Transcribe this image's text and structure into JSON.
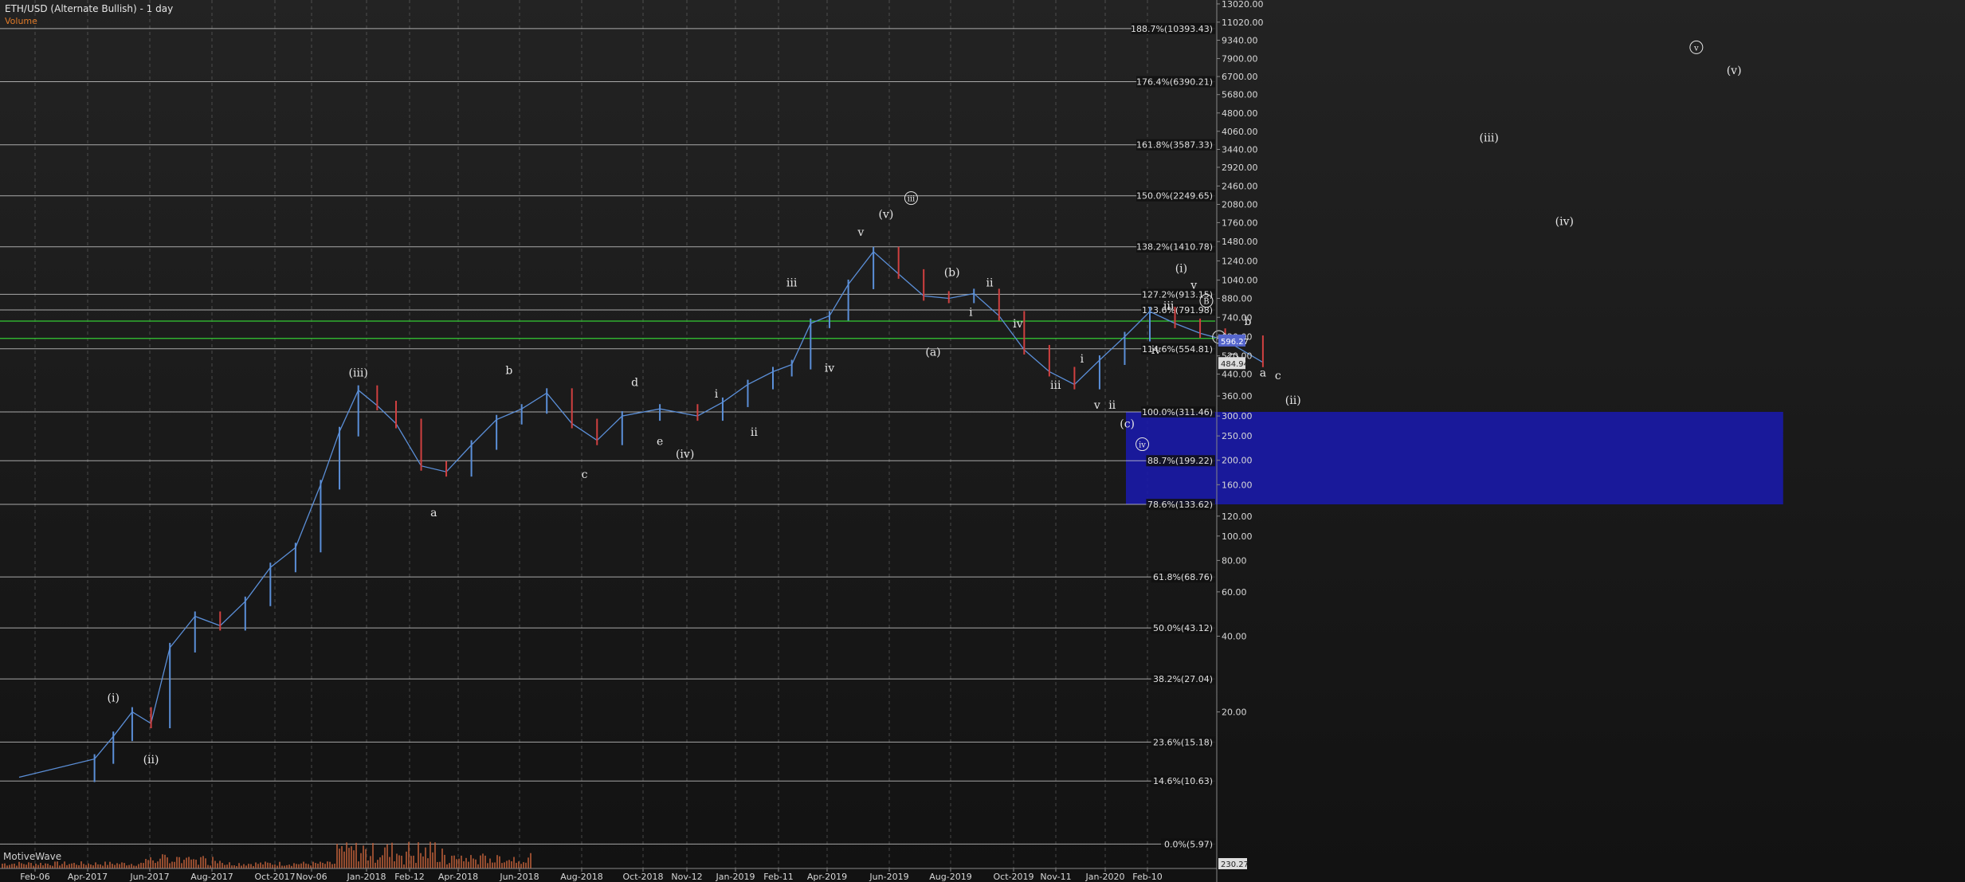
{
  "chart": {
    "title": "ETH/USD (Alternate Bullish) - 1 day",
    "volume_label": "Volume",
    "watermark": "MotiveWave"
  },
  "colors": {
    "background": "#1b1b1b",
    "grid": "#6a6a6a",
    "fib_line": "#d8d8d8",
    "support_line": "#33cc33",
    "box": "#1a1aa8",
    "candle_up": "#5b8fd8",
    "candle_down": "#d04040",
    "volume": "#c0603a",
    "label": "#e6e6e6",
    "current_price_bg": "#5566cc",
    "prev_price_bg": "#dddddd"
  },
  "chart_data": {
    "type": "line",
    "y_scale": "log",
    "ylim": [
      3.7,
      15500
    ],
    "x_tick_labels": [
      "Feb-06",
      "Apr-2017",
      "Jun-2017",
      "Aug-2017",
      "Oct-2017",
      "Nov-06",
      "Jan-2018",
      "Feb-12",
      "Apr-2018",
      "Jun-2018",
      "Aug-2018",
      "Oct-2018",
      "Nov-12",
      "Jan-2019",
      "Feb-11",
      "Apr-2019",
      "Jun-2019",
      "Aug-2019",
      "Oct-2019",
      "Nov-11",
      "Jan-2020",
      "Feb-10"
    ],
    "y_tick_labels": [
      13020,
      11020,
      9340,
      7900,
      6700,
      5680,
      4800,
      4060,
      3440,
      2920,
      2460,
      2080,
      1760,
      1480,
      1240,
      1040,
      880,
      740,
      620,
      520,
      440,
      360,
      300,
      250,
      200,
      160,
      120,
      100,
      80,
      60,
      40,
      20
    ],
    "fib_levels": [
      {
        "label": "188.7%(10393.43)",
        "value": 10393.43
      },
      {
        "label": "176.4%(6390.21)",
        "value": 6390.21
      },
      {
        "label": "161.8%(3587.33)",
        "value": 3587.33
      },
      {
        "label": "150.0%(2249.65)",
        "value": 2249.65
      },
      {
        "label": "138.2%(1410.78)",
        "value": 1410.78
      },
      {
        "label": "127.2%(913.15)",
        "value": 913.15
      },
      {
        "label": "123.6%(791.98)",
        "value": 791.98
      },
      {
        "label": "114.6%(554.81)",
        "value": 554.81
      },
      {
        "label": "100.0%(311.46)",
        "value": 311.46
      },
      {
        "label": "88.7%(199.22)",
        "value": 199.22
      },
      {
        "label": "78.6%(133.62)",
        "value": 133.62
      },
      {
        "label": "61.8%(68.76)",
        "value": 68.76
      },
      {
        "label": "50.0%(43.12)",
        "value": 43.12
      },
      {
        "label": "38.2%(27.04)",
        "value": 27.04
      },
      {
        "label": "23.6%(15.18)",
        "value": 15.18
      },
      {
        "label": "14.6%(10.63)",
        "value": 10.63
      },
      {
        "label": "0.0%(5.97)",
        "value": 5.97
      }
    ],
    "support_lines": [
      715,
      610
    ],
    "target_box": {
      "x_start": "May-2018",
      "x_end": "Jan-2019",
      "y_low": 133.62,
      "y_high": 311.46
    },
    "current_price": "596.27",
    "prev_price": "484.94",
    "volume_axis_label": "230.27",
    "price_series": [
      [
        "Feb-2017",
        11
      ],
      [
        "Mar-2017",
        13
      ],
      [
        "Mar-2017",
        16
      ],
      [
        "Mar-2017",
        20
      ],
      [
        "Mar-2017",
        18
      ],
      [
        "Apr-2017",
        36
      ],
      [
        "Apr-2017",
        48
      ],
      [
        "Apr-2017",
        44
      ],
      [
        "May-2017",
        55
      ],
      [
        "May-2017",
        75
      ],
      [
        "May-2017",
        90
      ],
      [
        "Jun-2017",
        160
      ],
      [
        "Jun-2017",
        260
      ],
      [
        "Jun-2017",
        380
      ],
      [
        "Jun-2017",
        330
      ],
      [
        "Jul-2017",
        280
      ],
      [
        "Jul-2017",
        190
      ],
      [
        "Jul-2017",
        180
      ],
      [
        "Aug-2017",
        230
      ],
      [
        "Aug-2017",
        290
      ],
      [
        "Aug-2017",
        320
      ],
      [
        "Sep-2017",
        370
      ],
      [
        "Sep-2017",
        280
      ],
      [
        "Sep-2017",
        240
      ],
      [
        "Oct-2017",
        300
      ],
      [
        "Oct-2017",
        320
      ],
      [
        "Nov-2017",
        300
      ],
      [
        "Nov-2017",
        340
      ],
      [
        "Nov-2017",
        400
      ],
      [
        "Dec-2017",
        450
      ],
      [
        "Dec-2017",
        480
      ],
      [
        "Dec-2017",
        700
      ],
      [
        "Dec-2017",
        750
      ],
      [
        "Jan-2018",
        1000
      ],
      [
        "Jan-2018",
        1350
      ],
      [
        "Jan-2018",
        1100
      ],
      [
        "Feb-2018",
        900
      ],
      [
        "Feb-2018",
        880
      ],
      [
        "Feb-2018",
        920
      ],
      [
        "Mar-2018",
        750
      ],
      [
        "Mar-2018",
        550
      ],
      [
        "Mar-2018",
        450
      ],
      [
        "Apr-2018",
        400
      ],
      [
        "Apr-2018",
        500
      ],
      [
        "Apr-2018",
        620
      ],
      [
        "May-2018",
        780
      ],
      [
        "May-2018",
        700
      ],
      [
        "May-2018",
        640
      ],
      [
        "Jun-2018",
        600
      ],
      [
        "Jun-2018",
        490
      ]
    ]
  },
  "wave_labels": [
    {
      "text": "(i)",
      "x": "Mar-2017",
      "y": 22
    },
    {
      "text": "(ii)",
      "x": "Mar-2017",
      "y": 12.5
    },
    {
      "text": "(iii)",
      "x": "Jun-2017",
      "y": 430
    },
    {
      "text": "a",
      "x": "Jul-2017",
      "y": 120
    },
    {
      "text": "b",
      "x": "Aug-2017",
      "y": 440
    },
    {
      "text": "c",
      "x": "Sep-2017",
      "y": 170
    },
    {
      "text": "d",
      "x": "Oct-2017",
      "y": 395
    },
    {
      "text": "e",
      "x": "Oct-2017",
      "y": 230
    },
    {
      "text": "(iv)",
      "x": "Oct-2017",
      "y": 205
    },
    {
      "text": "i",
      "x": "Nov-2017",
      "y": 355
    },
    {
      "text": "ii",
      "x": "Nov-2017",
      "y": 250
    },
    {
      "text": "iii",
      "x": "Dec-2017",
      "y": 980
    },
    {
      "text": "iv",
      "x": "Dec-2017",
      "y": 450
    },
    {
      "text": "v",
      "x": "Jan-2018",
      "y": 1560
    },
    {
      "text": "(v)",
      "x": "Jan-2018",
      "y": 1840
    },
    {
      "text": "iii",
      "x": "Jan-2018",
      "y": 2140,
      "circled": true
    },
    {
      "text": "(a)",
      "x": "Feb-2018",
      "y": 520
    },
    {
      "text": "(b)",
      "x": "Feb-2018",
      "y": 1080
    },
    {
      "text": "i",
      "x": "Feb-2018",
      "y": 750
    },
    {
      "text": "ii",
      "x": "Feb-2018",
      "y": 980
    },
    {
      "text": "iv",
      "x": "Mar-2018",
      "y": 675
    },
    {
      "text": "iii",
      "x": "Mar-2018",
      "y": 385
    },
    {
      "text": "i",
      "x": "Apr-2018",
      "y": 490
    },
    {
      "text": "v",
      "x": "Apr-2018",
      "y": 320
    },
    {
      "text": "ii",
      "x": "Apr-2018",
      "y": 320
    },
    {
      "text": "(c)",
      "x": "Apr-2018",
      "y": 270
    },
    {
      "text": "iv",
      "x": "Apr-2018",
      "y": 225,
      "circled": true
    },
    {
      "text": "iv",
      "x": "May-2018",
      "y": 530
    },
    {
      "text": "iii",
      "x": "May-2018",
      "y": 795
    },
    {
      "text": "(i)",
      "x": "May-2018",
      "y": 1120
    },
    {
      "text": "v",
      "x": "May-2018",
      "y": 960
    },
    {
      "text": "B",
      "x": "May-2018",
      "y": 835,
      "circled": true
    },
    {
      "text": "A",
      "x": "May-2018",
      "y": 600,
      "circled": true
    },
    {
      "text": "C",
      "x": "Jun-2018",
      "y": 485,
      "circled": true
    },
    {
      "text": "b",
      "x": "Jun-2018",
      "y": 690
    },
    {
      "text": "a",
      "x": "Jun-2018",
      "y": 430
    },
    {
      "text": "c",
      "x": "Jun-2018",
      "y": 420
    },
    {
      "text": "(ii)",
      "x": "Jun-2018",
      "y": 335
    },
    {
      "text": "(iii)",
      "x": "Sep-2018",
      "y": 3700
    },
    {
      "text": "(iv)",
      "x": "Oct-2018",
      "y": 1720
    },
    {
      "text": "v",
      "x": "Dec-2018",
      "y": 8500,
      "circled": true
    },
    {
      "text": "(v)",
      "x": "Dec-2018",
      "y": 6850
    }
  ]
}
